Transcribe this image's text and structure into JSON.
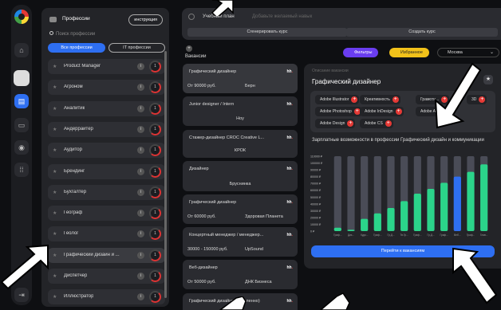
{
  "rail": {
    "icons": [
      "home-icon",
      "document-icon",
      "chat-icon",
      "camera-icon",
      "apps-icon",
      "logout-icon"
    ]
  },
  "left": {
    "title": "Профессии",
    "instructions": "инструкция",
    "search_placeholder": "Поиск профессии",
    "tab_all": "Все профессии",
    "tab_it": "IT профессии",
    "professions": [
      "Product Manager",
      "Агроном",
      "Аналитик",
      "Андеррайтер",
      "Аудитор",
      "Брендинг",
      "Бухгалтер",
      "Географ",
      "Геолог",
      "Графический дизайн и ...",
      "Диспетчер",
      "Иллюстратор"
    ],
    "info_symbol": "i",
    "ring_symbol": "1"
  },
  "top": {
    "plan_label": "Учебный план",
    "dream_placeholder": "Добавьте желаемый навык",
    "generate_course": "Сгенерировать курс",
    "create_course": "Создать курс"
  },
  "vacancies": {
    "title": "Вакансии",
    "add_symbol": "+",
    "filters": "Фильтры",
    "favorites": "Избранное",
    "city": "Москва",
    "hh_prefix": "hh",
    "hh_suffix": ".",
    "items": [
      {
        "title": "Графический дизайнер",
        "salary": "От 90000 руб.",
        "company": "Берн"
      },
      {
        "title": "Junior designer / Intern",
        "salary": "",
        "company": "Hoy"
      },
      {
        "title": "Стажер-дизайнер CROC Creative L...",
        "salary": "",
        "company": "КРОК"
      },
      {
        "title": "Дизайнер",
        "salary": "",
        "company": "Бруснинка"
      },
      {
        "title": "Графический дизайнер",
        "salary": "От 60000 руб.",
        "company": "Здоровая Планета"
      },
      {
        "title": "Концертный менеджер / менеджер...",
        "salary": "30000 - 150000 руб.",
        "company": "UpSound"
      },
      {
        "title": "Веб-дизайнер",
        "salary": "От 50000 руб.",
        "company": "ДНК Бизнеса"
      },
      {
        "title": "Графический дизайнер (удаленно)",
        "salary": "",
        "company": ""
      }
    ]
  },
  "detail": {
    "subtitle": "Описание вакансии",
    "title": "Графический дизайнер",
    "skills": [
      "Adobe Illustrator",
      "Креативность",
      "Грамотн...",
      "3D",
      "Adobe Photoshop",
      "Adobe InDesign",
      "Adobe A...",
      "Adobe Design",
      "Adobe CS"
    ],
    "chart_title": "Зарплатные возможности в профессии Графический дизайн и коммуникации",
    "goto_button": "Перейти к вакансиям"
  },
  "chart_data": {
    "type": "bar",
    "title": "Зарплатные возможности в профессии Графический дизайн и коммуникации",
    "y_ticks": [
      "110000 ₽",
      "100000 ₽",
      "90000 ₽",
      "80000 ₽",
      "70000 ₽",
      "60000 ₽",
      "50000 ₽",
      "40000 ₽",
      "30000 ₽",
      "20000 ₽",
      "10000 ₽",
      "0 ₽"
    ],
    "categories": [
      "Граф...",
      "Диз...",
      "Худо...",
      "Граф...",
      "Гр.Д...",
      "Тв.Гр...",
      "Граф...",
      "Гр.Д...",
      "Граф...",
      "Веб...",
      "Граф...",
      "Глав..."
    ],
    "values": [
      5000,
      2000,
      18000,
      26000,
      34000,
      44000,
      55000,
      62000,
      71000,
      80000,
      87000,
      98000
    ],
    "highlight_index": 9,
    "colors": {
      "bar": "#2bd48a",
      "highlight": "#2e6ff2",
      "track": "#4a4c57"
    },
    "ylim": [
      0,
      110000
    ]
  }
}
